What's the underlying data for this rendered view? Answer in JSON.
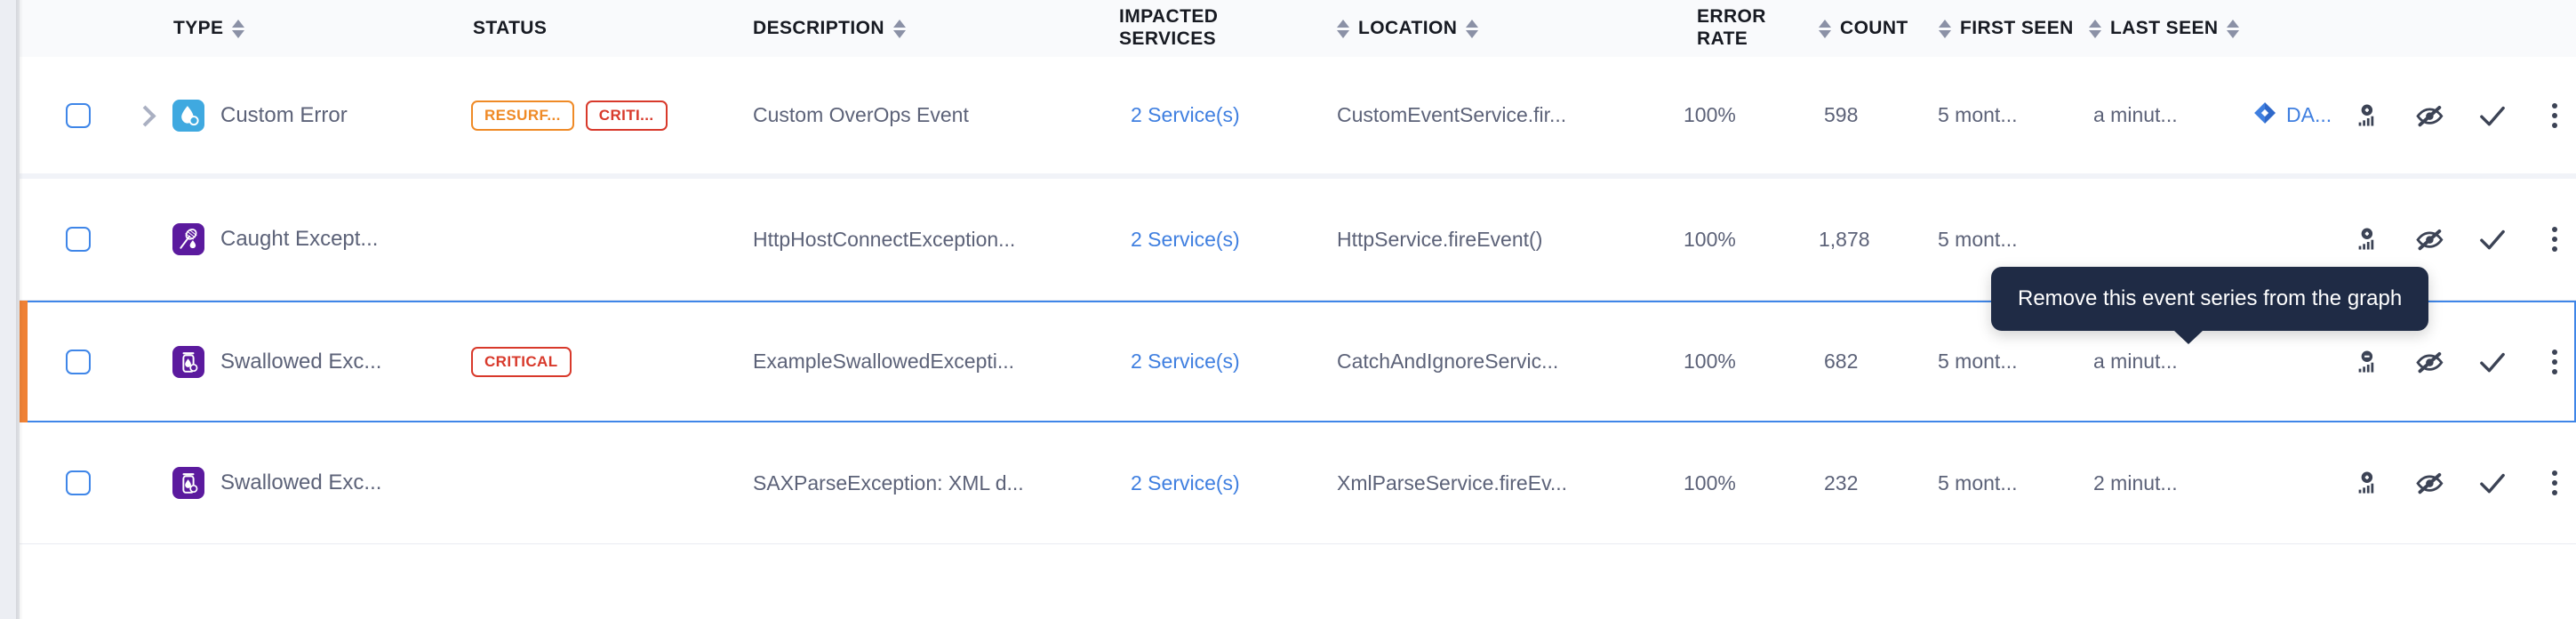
{
  "table": {
    "columns": [
      {
        "key": "type",
        "label": "TYPE",
        "sortable": true,
        "two_line": false
      },
      {
        "key": "status",
        "label": "STATUS",
        "sortable": false,
        "two_line": false
      },
      {
        "key": "description",
        "label": "DESCRIPTION",
        "sortable": true,
        "two_line": false
      },
      {
        "key": "impacted",
        "label_lines": [
          "IMPACTED",
          "SERVICES"
        ],
        "label": "IMPACTED SERVICES",
        "sortable": false,
        "two_line": true
      },
      {
        "key": "location",
        "label": "LOCATION",
        "sortable": true,
        "sorter_before": true,
        "two_line": false
      },
      {
        "key": "error_rate",
        "label_lines": [
          "ERROR",
          "RATE"
        ],
        "label": "ERROR RATE",
        "sortable": false,
        "two_line": true
      },
      {
        "key": "count",
        "label": "COUNT",
        "sortable": true,
        "sorter_before": true,
        "two_line": false
      },
      {
        "key": "first_seen",
        "label": "FIRST SEEN",
        "sortable": true,
        "sorter_before": true,
        "two_line": false
      },
      {
        "key": "last_seen",
        "label": "LAST SEEN",
        "sortable": true,
        "sorter_before": true,
        "two_line": false
      }
    ],
    "rows": [
      {
        "checkbox_checked": false,
        "expandable": true,
        "type_icon": "custom-error-icon",
        "type_icon_color": "#3fa9e0",
        "type": "Custom Error",
        "status_chips": [
          {
            "label": "RESURF...",
            "kind": "resurfaced"
          },
          {
            "label": "CRITI...",
            "kind": "critical"
          }
        ],
        "description": "Custom OverOps Event",
        "impacted_services": "2 Service(s)",
        "location": "CustomEventService.fir...",
        "error_rate": "100%",
        "count": "598",
        "first_seen": "5 mont...",
        "last_seen": "a minut...",
        "jira": "DA...",
        "graph_action": "add-to-graph",
        "selected": false
      },
      {
        "checkbox_checked": false,
        "expandable": false,
        "type_icon": "caught-exception-icon",
        "type_icon_color": "#5b1a9e",
        "type": "Caught Except...",
        "status_chips": [],
        "description": "HttpHostConnectException...",
        "impacted_services": "2 Service(s)",
        "location": "HttpService.fireEvent()",
        "error_rate": "100%",
        "count": "1,878",
        "first_seen": "5 mont...",
        "last_seen": "",
        "jira": "",
        "graph_action": "add-to-graph",
        "selected": false
      },
      {
        "checkbox_checked": false,
        "expandable": false,
        "type_icon": "swallowed-exception-icon",
        "type_icon_color": "#5b1a9e",
        "type": "Swallowed Exc...",
        "status_chips": [
          {
            "label": "CRITICAL",
            "kind": "critical"
          }
        ],
        "description": "ExampleSwallowedExcepti...",
        "impacted_services": "2 Service(s)",
        "location": "CatchAndIgnoreServic...",
        "error_rate": "100%",
        "count": "682",
        "first_seen": "5 mont...",
        "last_seen": "a minut...",
        "jira": "",
        "graph_action": "remove-from-graph",
        "selected": true
      },
      {
        "checkbox_checked": false,
        "expandable": false,
        "type_icon": "swallowed-exception-icon",
        "type_icon_color": "#5b1a9e",
        "type": "Swallowed Exc...",
        "status_chips": [],
        "description": "SAXParseException: XML d...",
        "impacted_services": "2 Service(s)",
        "location": "XmlParseService.fireEv...",
        "error_rate": "100%",
        "count": "232",
        "first_seen": "5 mont...",
        "last_seen": "2 minut...",
        "jira": "",
        "graph_action": "add-to-graph",
        "selected": false
      }
    ],
    "row_action_icons": [
      "graph-toggle-icon",
      "hide-event-icon",
      "resolve-check-icon",
      "more-options-icon"
    ]
  },
  "tooltip": {
    "text": "Remove this event series from the graph"
  },
  "colors": {
    "accent_blue": "#3f7fe0",
    "critical_red": "#d8392b",
    "resurfaced_orange": "#ef8a26",
    "selected_marker": "#ef8135",
    "tooltip_bg": "#1f2b45"
  }
}
